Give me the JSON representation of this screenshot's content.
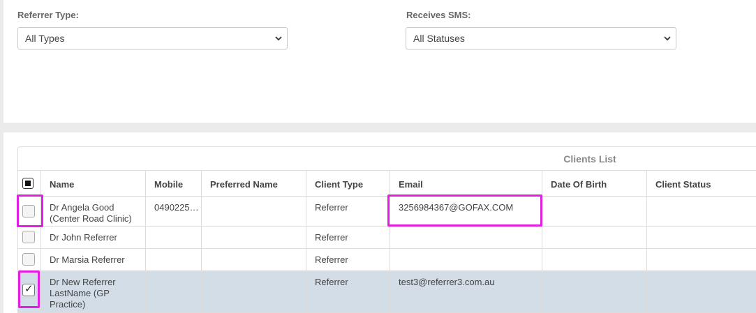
{
  "filters": {
    "referrer_type": {
      "label": "Referrer Type:",
      "value": "All Types"
    },
    "receives_sms": {
      "label": "Receives SMS:",
      "value": "All Statuses"
    }
  },
  "table": {
    "caption": "Clients List",
    "columns": [
      "Name",
      "Mobile",
      "Preferred Name",
      "Client Type",
      "Email",
      "Date Of Birth",
      "Client Status"
    ],
    "rows": [
      {
        "name": "Dr Angela Good (Center Road Clinic)",
        "mobile": "0490225…",
        "preferred": "",
        "type": "Referrer",
        "email": "3256984367@GOFAX.COM",
        "dob": "",
        "status": "",
        "checked": false
      },
      {
        "name": "Dr John Referrer",
        "mobile": "",
        "preferred": "",
        "type": "Referrer",
        "email": "",
        "dob": "",
        "status": "",
        "checked": false
      },
      {
        "name": "Dr Marsia Referrer",
        "mobile": "",
        "preferred": "",
        "type": "Referrer",
        "email": "",
        "dob": "",
        "status": "",
        "checked": false
      },
      {
        "name": "Dr New Referrer LastName (GP Practice)",
        "mobile": "",
        "preferred": "",
        "type": "Referrer",
        "email": "test3@referrer3.com.au",
        "dob": "",
        "status": "",
        "checked": true
      }
    ]
  },
  "highlight_color": "#e21ee0",
  "selected_row_color": "#d2dde8",
  "icons": {
    "checkmark": "✓",
    "dropdown": "chevron-down-icon"
  }
}
